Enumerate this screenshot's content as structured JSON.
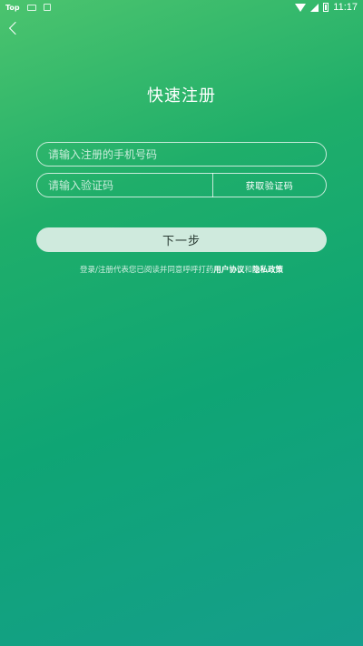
{
  "status_bar": {
    "app_label": "Top",
    "time": "11:17"
  },
  "icons": {
    "back": "chevron-left-icon",
    "wifi": "wifi-icon",
    "signal": "signal-icon",
    "battery": "battery-icon"
  },
  "page": {
    "title": "快速注册"
  },
  "form": {
    "phone_placeholder": "请输入注册的手机号码",
    "code_placeholder": "请输入验证码",
    "get_code_label": "获取验证码",
    "next_label": "下一步"
  },
  "agreement": {
    "prefix": "登录/注册代表您已阅读并同意呼呼打药",
    "user_agreement": "用户协议",
    "and": "和",
    "privacy_policy": "隐私政策"
  },
  "colors": {
    "gradient_top": "#4cc46e",
    "gradient_bottom": "#159e8c",
    "next_button_bg": "#cfeadd"
  }
}
